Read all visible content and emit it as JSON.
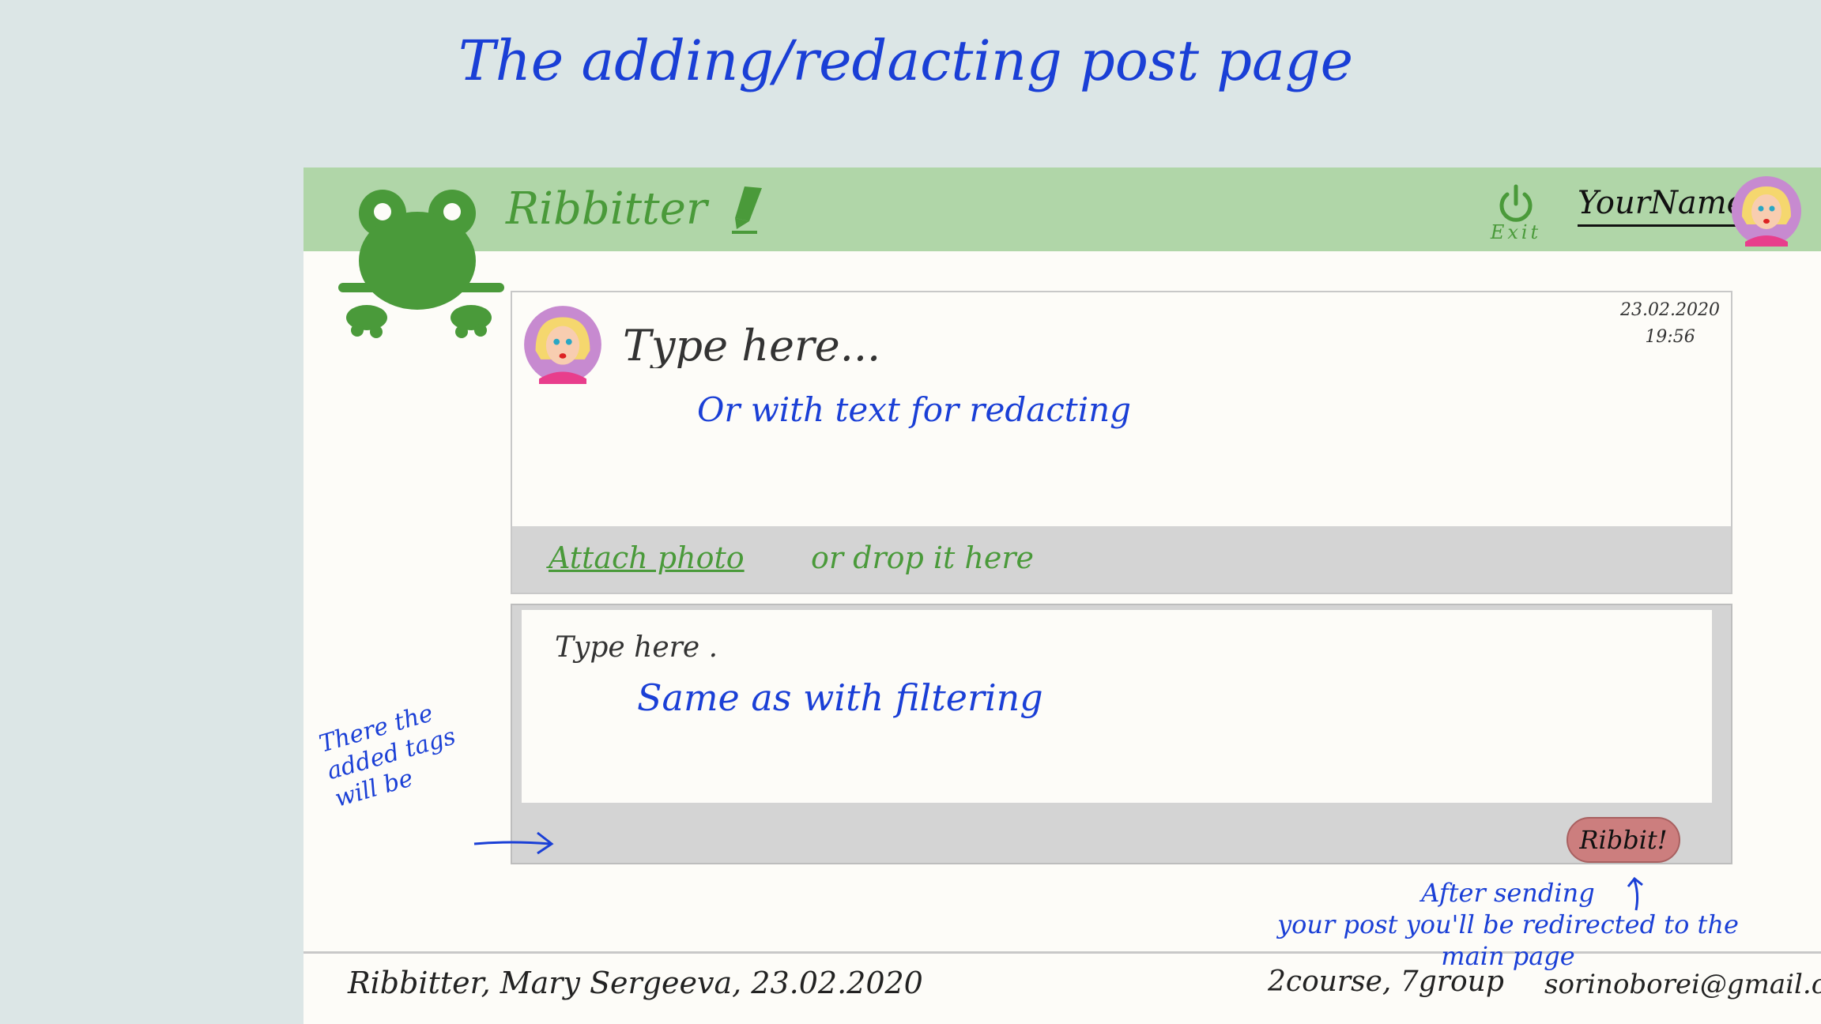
{
  "page_title": "The adding/redacting post page",
  "header": {
    "brand": "Ribbitter",
    "exit_label": "Exit",
    "user_name": "YourName"
  },
  "post": {
    "placeholder": "Type here...",
    "hint": "Or with text for redacting",
    "date": "23.02.2020",
    "time": "19:56",
    "attach_link": "Attach photo",
    "attach_rest": "or drop it here"
  },
  "tags": {
    "placeholder": "Type here .",
    "hint": "Same as with filtering",
    "note_line1": "There the",
    "note_line2": "added tags",
    "note_line3": "will be"
  },
  "ribbit_button": "Ribbit!",
  "redirect_note": {
    "line1": "After sending",
    "line2": "your post you'll be redirected to the",
    "line3": "main page"
  },
  "footer": {
    "left": "Ribbitter, Mary Sergeeva, 23.02.2020",
    "middle": "2course, 7group",
    "email": "sorinoborei@gmail.com"
  },
  "colors": {
    "header_bg": "#b0d6a8",
    "brand_green": "#4a9a3a",
    "annotation_blue": "#1a3fd6",
    "ribbit_button": "#cc7e7e",
    "panel_gray": "#d4d4d4"
  },
  "icons": [
    "frog-logo-icon",
    "pencil-icon",
    "power-icon",
    "avatar-icon"
  ]
}
